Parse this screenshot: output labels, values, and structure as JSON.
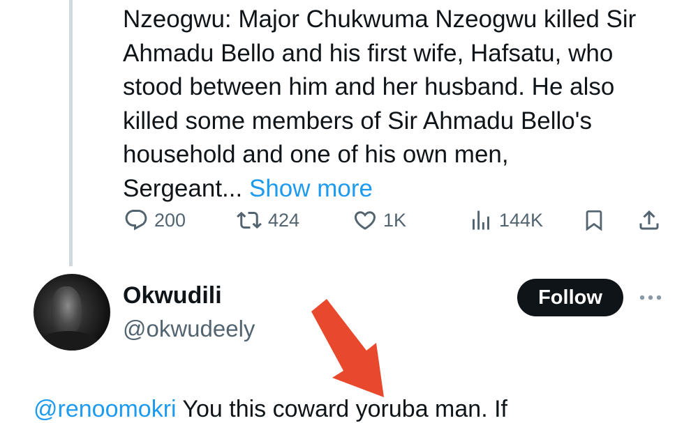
{
  "tweet": {
    "lines": [
      "Nzeogwu: Major Chukwuma Nzeogwu killed Sir",
      "Ahmadu Bello and his first wife, Hafsatu, who",
      "stood between him and her husband. He also",
      "killed some members of Sir Ahmadu Bello's",
      "household and one of his own men,",
      "Sergeant..."
    ],
    "show_more": "Show more"
  },
  "actions": {
    "reply": {
      "icon": "reply-icon",
      "count": "200"
    },
    "retweet": {
      "icon": "retweet-icon",
      "count": "424"
    },
    "like": {
      "icon": "heart-icon",
      "count": "1K"
    },
    "views": {
      "icon": "views-icon",
      "count": "144K"
    },
    "bookmark": {
      "icon": "bookmark-icon"
    },
    "share": {
      "icon": "share-icon"
    }
  },
  "reply_tweet": {
    "display_name": "Okwudili",
    "handle": "@okwudeely",
    "follow_label": "Follow",
    "mention": "@renoomokri",
    "text": " You this coward yoruba man. If"
  },
  "colors": {
    "accent": "#1d9bf0",
    "text_primary": "#0f1419",
    "text_secondary": "#536471",
    "thread_line": "#cfd9de",
    "annotation_arrow": "#e8482c"
  }
}
